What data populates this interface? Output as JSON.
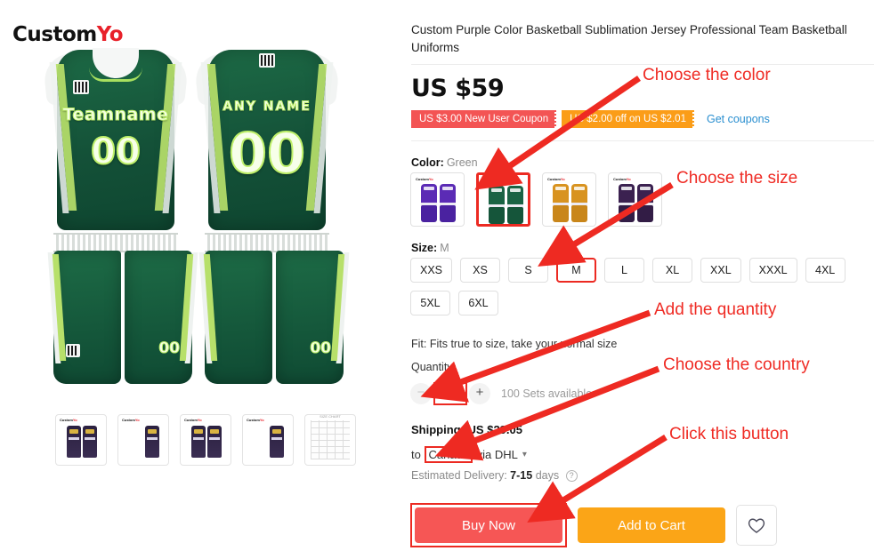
{
  "brand": {
    "name_black": "Custom",
    "name_red": "Yo"
  },
  "gallery": {
    "front_jersey": {
      "team_text": "Teamname",
      "number": "00",
      "shorts_number": "00"
    },
    "back_jersey": {
      "name_text": "ANY NAME",
      "number": "00",
      "shorts_number": "00"
    },
    "thumbnails": [
      {
        "label": "thumb-1",
        "type": "jersey"
      },
      {
        "label": "thumb-2",
        "type": "jersey"
      },
      {
        "label": "thumb-3",
        "type": "jersey"
      },
      {
        "label": "thumb-4",
        "type": "jersey"
      },
      {
        "label": "thumb-5",
        "type": "size-chart",
        "chart_title": "SIZE CHART"
      }
    ]
  },
  "product": {
    "title": "Custom Purple Color Basketball Sublimation Jersey Professional Team Basketball Uniforms",
    "price": "US $59",
    "coupons": [
      {
        "text": "US $3.00 New User Coupon",
        "color": "#f35454"
      },
      {
        "text": "US $2.00 off on US $2.01",
        "color": "#fb9d18"
      }
    ],
    "get_coupons_link": "Get coupons",
    "color": {
      "label": "Color:",
      "value": "Green",
      "options": [
        {
          "name": "Purple",
          "jersey": "#5b2bb5",
          "shorts": "#4a22a0",
          "selected": false
        },
        {
          "name": "Green",
          "jersey": "#1a6344",
          "shorts": "#15553a",
          "selected": true
        },
        {
          "name": "Gold",
          "jersey": "#d89320",
          "shorts": "#c9861a",
          "selected": false
        },
        {
          "name": "Dark Purple",
          "jersey": "#3b2150",
          "shorts": "#321c45",
          "selected": false
        }
      ]
    },
    "size": {
      "label": "Size:",
      "value": "M",
      "options": [
        {
          "label": "XXS",
          "selected": false
        },
        {
          "label": "XS",
          "selected": false
        },
        {
          "label": "S",
          "selected": false
        },
        {
          "label": "M",
          "selected": true
        },
        {
          "label": "L",
          "selected": false
        },
        {
          "label": "XL",
          "selected": false
        },
        {
          "label": "XXL",
          "selected": false
        },
        {
          "label": "XXXL",
          "selected": false
        },
        {
          "label": "4XL",
          "selected": false
        },
        {
          "label": "5XL",
          "selected": false
        },
        {
          "label": "6XL",
          "selected": false
        }
      ]
    },
    "fit_text": "Fit: Fits true to size, take your normal size",
    "quantity": {
      "label": "Quantity:",
      "value": "1",
      "minus": "−",
      "plus": "+",
      "stock_text": "100 Sets available"
    },
    "shipping": {
      "line": "Shipping: US $29.05",
      "to_prefix": "to",
      "country": "Canada",
      "via": "via DHL",
      "chevron": "⌄",
      "delivery_label": "Estimated Delivery:",
      "delivery_value": "7-15",
      "delivery_suffix": "days",
      "help_icon": "?"
    },
    "buttons": {
      "buy_now": "Buy Now",
      "add_to_cart": "Add to Cart",
      "wishlist_icon": "♡"
    }
  },
  "annotations": [
    {
      "id": "a1",
      "text": "Choose the color"
    },
    {
      "id": "a2",
      "text": "Choose the size"
    },
    {
      "id": "a3",
      "text": "Add the quantity"
    },
    {
      "id": "a4",
      "text": "Choose the country"
    },
    {
      "id": "a5",
      "text": "Click this button"
    }
  ],
  "accent": {
    "red": "#ec2a22",
    "orange": "#fba517",
    "buy": "#f65655",
    "link": "#2a8fd0"
  }
}
